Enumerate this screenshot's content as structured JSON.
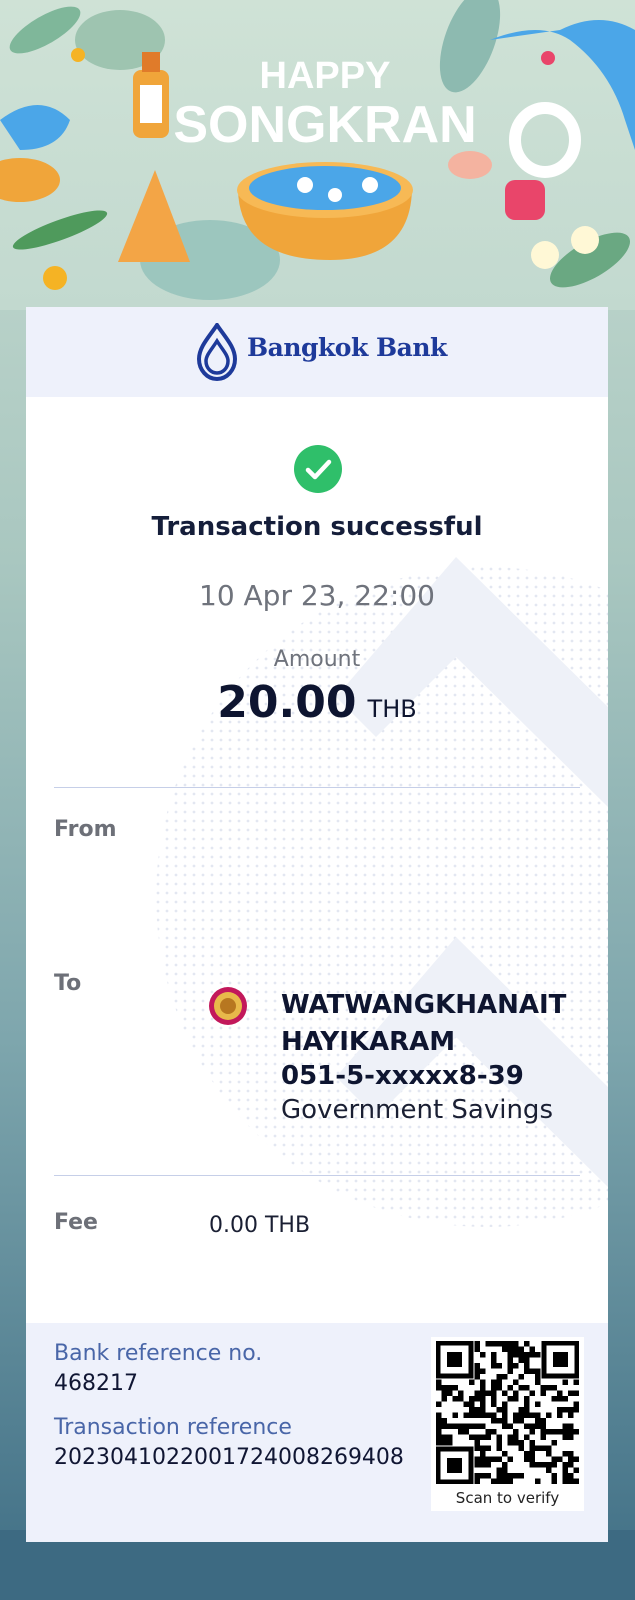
{
  "banner": {
    "line1": "HAPPY",
    "line2": "SONGKRAN"
  },
  "bank": {
    "name": "Bangkok Bank",
    "brand_color": "#1e3a9a"
  },
  "status": {
    "icon": "checkmark-icon",
    "title": "Transaction successful",
    "datetime": "10 Apr 23, 22:00",
    "success_color": "#2fbf6a"
  },
  "amount": {
    "label": "Amount",
    "value": "20.00",
    "currency": "THB"
  },
  "from": {
    "label": "From"
  },
  "to": {
    "label": "To",
    "icon": "temple-seal-icon",
    "name": "WATWANGKHANAIT HAYIKARAM",
    "account": "051-5-xxxxx8-39",
    "bank": "Government Savings"
  },
  "fee": {
    "label": "Fee",
    "value": "0.00 THB"
  },
  "reference": {
    "bank_ref_label": "Bank reference no.",
    "bank_ref_value": "468217",
    "txn_ref_label": "Transaction reference",
    "txn_ref_value": "2023041022001724008269408",
    "qr_caption": "Scan to verify"
  }
}
